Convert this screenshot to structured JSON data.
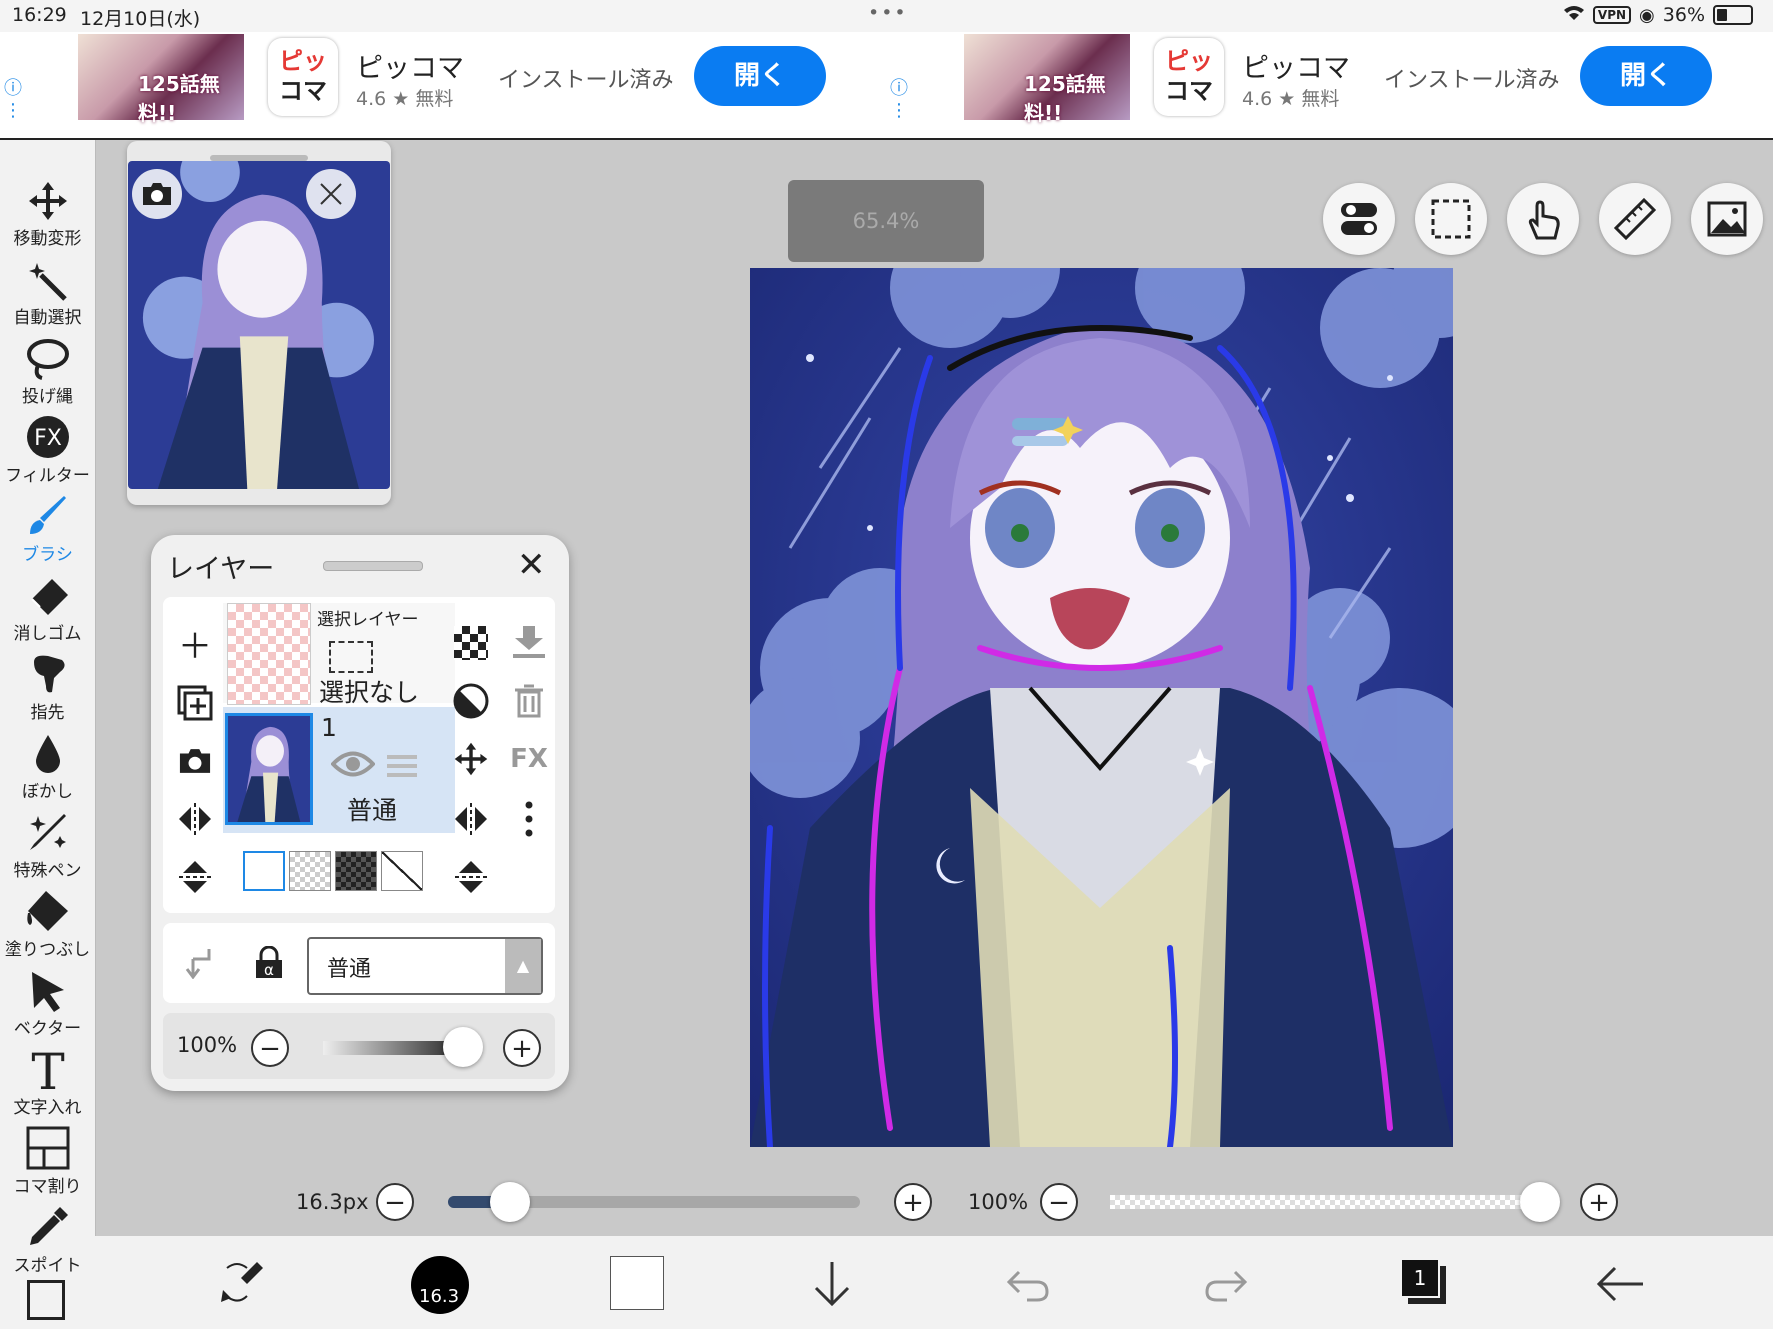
{
  "status": {
    "time": "16:29",
    "date": "12月10日(水)",
    "vpn": "VPN",
    "battery": "36%"
  },
  "ads": [
    {
      "banner_text": "125話無料!!",
      "app_name": "ピッコマ",
      "rating": "4.6 ★  無料",
      "installed": "インストール済み",
      "open": "開く",
      "icon_top": "ピッ",
      "icon_bottom": "コマ"
    },
    {
      "banner_text": "125話無料!!",
      "app_name": "ピッコマ",
      "rating": "4.6 ★  無料",
      "installed": "インストール済み",
      "open": "開く",
      "icon_top": "ピッ",
      "icon_bottom": "コマ"
    }
  ],
  "tools": [
    {
      "label": "移動変形",
      "icon": "move-icon"
    },
    {
      "label": "自動選択",
      "icon": "magic-wand-icon"
    },
    {
      "label": "投げ縄",
      "icon": "lasso-icon"
    },
    {
      "label": "フィルター",
      "icon": "fx-icon"
    },
    {
      "label": "ブラシ",
      "icon": "brush-icon",
      "active": true
    },
    {
      "label": "消しゴム",
      "icon": "eraser-icon"
    },
    {
      "label": "指先",
      "icon": "finger-icon"
    },
    {
      "label": "ぼかし",
      "icon": "blur-icon"
    },
    {
      "label": "特殊ペン",
      "icon": "special-pen-icon"
    },
    {
      "label": "塗りつぶし",
      "icon": "fill-icon"
    },
    {
      "label": "ベクター",
      "icon": "vector-icon"
    },
    {
      "label": "文字入れ",
      "icon": "text-icon"
    },
    {
      "label": "コマ割り",
      "icon": "panel-icon"
    },
    {
      "label": "スポイト",
      "icon": "eyedropper-icon"
    }
  ],
  "zoom": "65.4%",
  "layer_panel": {
    "title": "レイヤー",
    "selection_layer": {
      "name": "選択レイヤー",
      "state": "選択なし"
    },
    "layer1": {
      "number": "1",
      "blend": "普通"
    },
    "blend_mode": "普通",
    "opacity": "100%",
    "fx": "FX"
  },
  "brush": {
    "size": "16.3px",
    "opacity": "100%",
    "size_fraction": 0.15,
    "opacity_fraction": 1.0
  },
  "bottom": {
    "brush_size": "16.3",
    "layer_count": "1"
  },
  "colors": {
    "accent": "#1e88e5",
    "open_button": "#0a7cf2",
    "primary_color": "#000000",
    "secondary_color": "#ffffff"
  }
}
